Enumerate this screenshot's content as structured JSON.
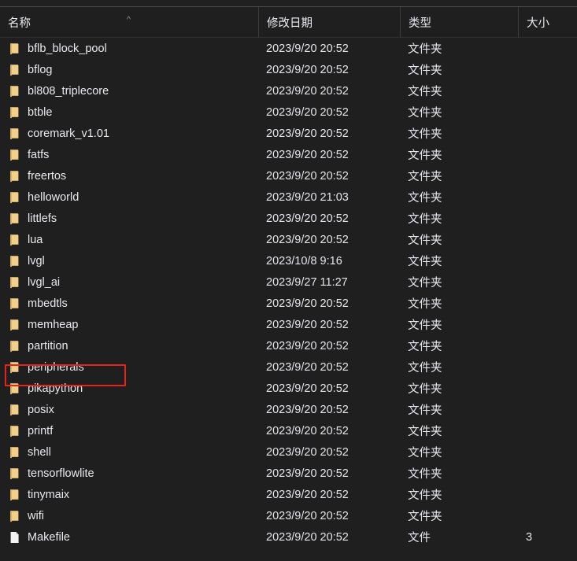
{
  "window": {
    "kind": "file-explorer-list-view",
    "background_color": "#1f1f1f",
    "text_color": "#e8eaf0"
  },
  "header": {
    "sort_indicator": "^",
    "sort_column": "名称",
    "sort_direction": "ascending",
    "columns": [
      {
        "key": "name",
        "label": "名称"
      },
      {
        "key": "date",
        "label": "修改日期"
      },
      {
        "key": "type",
        "label": "类型"
      },
      {
        "key": "size",
        "label": "大小"
      }
    ]
  },
  "annotation": {
    "color": "#e8231c",
    "target_row": "peripherals",
    "shape": "rectangle"
  },
  "rows": [
    {
      "icon": "folder-icon",
      "name": "bflb_block_pool",
      "date": "2023/9/20 20:52",
      "type": "文件夹",
      "size": ""
    },
    {
      "icon": "folder-icon",
      "name": "bflog",
      "date": "2023/9/20 20:52",
      "type": "文件夹",
      "size": ""
    },
    {
      "icon": "folder-icon",
      "name": "bl808_triplecore",
      "date": "2023/9/20 20:52",
      "type": "文件夹",
      "size": ""
    },
    {
      "icon": "folder-icon",
      "name": "btble",
      "date": "2023/9/20 20:52",
      "type": "文件夹",
      "size": ""
    },
    {
      "icon": "folder-icon",
      "name": "coremark_v1.01",
      "date": "2023/9/20 20:52",
      "type": "文件夹",
      "size": ""
    },
    {
      "icon": "folder-icon",
      "name": "fatfs",
      "date": "2023/9/20 20:52",
      "type": "文件夹",
      "size": ""
    },
    {
      "icon": "folder-icon",
      "name": "freertos",
      "date": "2023/9/20 20:52",
      "type": "文件夹",
      "size": ""
    },
    {
      "icon": "folder-icon",
      "name": "helloworld",
      "date": "2023/9/20 21:03",
      "type": "文件夹",
      "size": ""
    },
    {
      "icon": "folder-icon",
      "name": "littlefs",
      "date": "2023/9/20 20:52",
      "type": "文件夹",
      "size": ""
    },
    {
      "icon": "folder-icon",
      "name": "lua",
      "date": "2023/9/20 20:52",
      "type": "文件夹",
      "size": ""
    },
    {
      "icon": "folder-icon",
      "name": "lvgl",
      "date": "2023/10/8 9:16",
      "type": "文件夹",
      "size": ""
    },
    {
      "icon": "folder-icon",
      "name": "lvgl_ai",
      "date": "2023/9/27 11:27",
      "type": "文件夹",
      "size": ""
    },
    {
      "icon": "folder-icon",
      "name": "mbedtls",
      "date": "2023/9/20 20:52",
      "type": "文件夹",
      "size": ""
    },
    {
      "icon": "folder-icon",
      "name": "memheap",
      "date": "2023/9/20 20:52",
      "type": "文件夹",
      "size": ""
    },
    {
      "icon": "folder-icon",
      "name": "partition",
      "date": "2023/9/20 20:52",
      "type": "文件夹",
      "size": ""
    },
    {
      "icon": "folder-icon",
      "name": "peripherals",
      "date": "2023/9/20 20:52",
      "type": "文件夹",
      "size": ""
    },
    {
      "icon": "folder-icon",
      "name": "pikapython",
      "date": "2023/9/20 20:52",
      "type": "文件夹",
      "size": ""
    },
    {
      "icon": "folder-icon",
      "name": "posix",
      "date": "2023/9/20 20:52",
      "type": "文件夹",
      "size": ""
    },
    {
      "icon": "folder-icon",
      "name": "printf",
      "date": "2023/9/20 20:52",
      "type": "文件夹",
      "size": ""
    },
    {
      "icon": "folder-icon",
      "name": "shell",
      "date": "2023/9/20 20:52",
      "type": "文件夹",
      "size": ""
    },
    {
      "icon": "folder-icon",
      "name": "tensorflowlite",
      "date": "2023/9/20 20:52",
      "type": "文件夹",
      "size": ""
    },
    {
      "icon": "folder-icon",
      "name": "tinymaix",
      "date": "2023/9/20 20:52",
      "type": "文件夹",
      "size": ""
    },
    {
      "icon": "folder-icon",
      "name": "wifi",
      "date": "2023/9/20 20:52",
      "type": "文件夹",
      "size": ""
    },
    {
      "icon": "document-icon",
      "name": "Makefile",
      "date": "2023/9/20 20:52",
      "type": "文件",
      "size": "3"
    }
  ]
}
